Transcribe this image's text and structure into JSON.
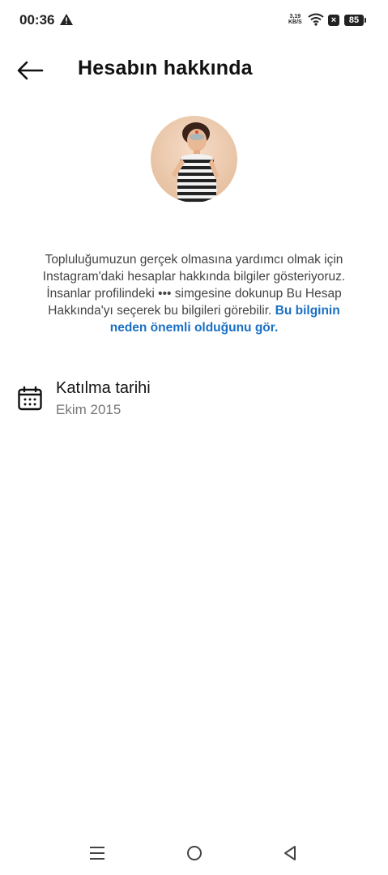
{
  "status_bar": {
    "time": "00:36",
    "net_speed_value": "3,19",
    "net_speed_unit": "KB/S",
    "battery": "85"
  },
  "header": {
    "title": "Hesabın hakkında"
  },
  "description": {
    "text": "Topluluğumuzun gerçek olmasına yardımcı olmak için Instagram'daki hesaplar hakkında bilgiler gösteriyoruz. İnsanlar profilindeki ••• simgesine dokunup Bu Hesap Hakkında'yı seçerek bu bilgileri görebilir. ",
    "link": "Bu bilginin neden önemli olduğunu gör."
  },
  "join_date": {
    "label": "Katılma tarihi",
    "value": "Ekim 2015"
  },
  "colors": {
    "link": "#1a6fc4",
    "text": "#111111",
    "muted": "#777777"
  },
  "icons": [
    "warning-icon",
    "wifi-icon",
    "close-icon",
    "back-arrow-icon",
    "calendar-icon",
    "menu-icon",
    "home-circle-icon",
    "back-triangle-icon"
  ]
}
